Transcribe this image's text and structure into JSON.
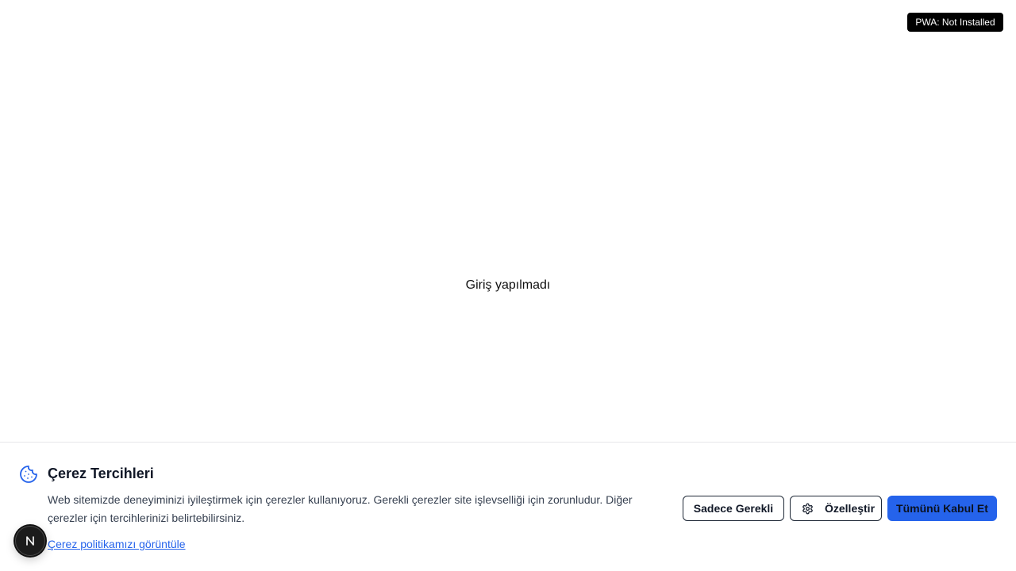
{
  "pwa_status": {
    "label": "PWA: Not Installed"
  },
  "main": {
    "status_text": "Giriş yapılmadı"
  },
  "cookie_banner": {
    "icon": "cookie-icon",
    "title": "Çerez Tercihleri",
    "description": "Web sitemizde deneyiminizi iyileştirmek için çerezler kullanıyoruz. Gerekli çerezler site işlevselliği için zorunludur. Diğer çerezler için tercihlerinizi belirtebilirsiniz.",
    "policy_link": "Çerez politikamızı görüntüle",
    "buttons": {
      "essential_only": "Sadece Gerekli",
      "customize": "Özelleştir",
      "customize_icon": "gear-icon",
      "accept_all": "Tümünü Kabul Et"
    },
    "colors": {
      "accent": "#2563eb",
      "title": "#111827",
      "text": "#374151"
    }
  },
  "next_badge": {
    "icon": "nextjs-logo-icon",
    "color": "#1b1b1b"
  }
}
